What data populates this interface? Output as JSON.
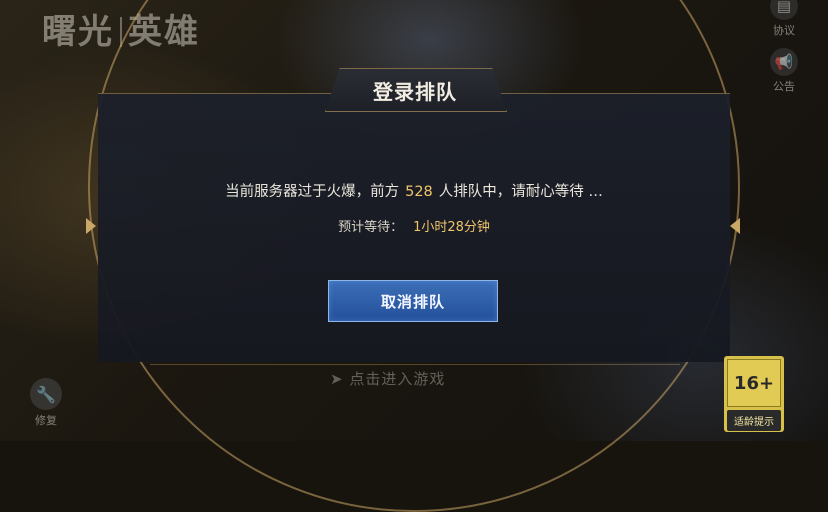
{
  "brand": {
    "logo_left": "曙光",
    "logo_right": "英雄"
  },
  "top_right": {
    "agreement_label": "协议",
    "notice_label": "公告"
  },
  "dialog": {
    "title": "登录排队",
    "queue_prefix": "当前服务器过于火爆，前方",
    "queue_count": "528",
    "queue_suffix": "人排队中，请耐心等待 …",
    "eta_label": "预计等待：",
    "eta_value": "1小时28分钟",
    "cancel_label": "取消排队"
  },
  "bottom": {
    "enter_game_label": "➤ 点击进入游戏",
    "repair_label": "修复",
    "age_rating": "16+",
    "age_hint_label": "适龄提示"
  },
  "colors": {
    "accent_gold": "#f0c46a",
    "button_blue": "#23509a",
    "frame_gold": "#c9a766"
  },
  "icons": {
    "agreement": "document-icon",
    "notice": "megaphone-icon",
    "repair": "wrench-icon"
  }
}
